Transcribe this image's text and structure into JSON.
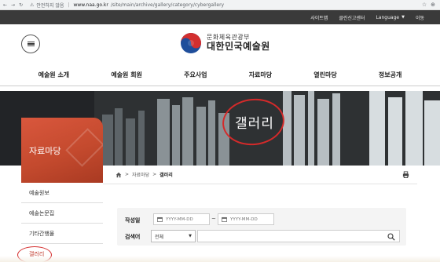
{
  "browser": {
    "security_label": "안전하지 않음",
    "url_host": "www.naa.go.kr",
    "url_path": "/site/main/archive/gallery/category/cybergallery"
  },
  "util_bar": {
    "items": [
      "사이트맵",
      "클린신고센터",
      "Language",
      "이동"
    ]
  },
  "header": {
    "logo_sub": "문화체육관광부",
    "logo_main": "대한민국예술원"
  },
  "gnb": {
    "items": [
      "예술원 소개",
      "예술원 회원",
      "주요사업",
      "자료마당",
      "열린마당",
      "정보공개"
    ]
  },
  "banner": {
    "title": "갤러리"
  },
  "sidebar": {
    "title": "자료마당",
    "items": [
      {
        "label": "예술원보",
        "active": false
      },
      {
        "label": "예술논문집",
        "active": false
      },
      {
        "label": "기타간행물",
        "active": false
      },
      {
        "label": "갤러리",
        "active": true
      }
    ]
  },
  "breadcrumb": {
    "level1": "자료마당",
    "current": "갤러리"
  },
  "search": {
    "date_label": "작성일",
    "date_from_placeholder": "YYYY-MM-DD",
    "date_to_placeholder": "YYYY-MM-DD",
    "tilde": "~",
    "keyword_label": "검색어",
    "select_value": "전체",
    "keyword_value": ""
  },
  "colors": {
    "accent": "#c44a2e",
    "annotation": "#d42a2a",
    "util_bar_bg": "#3a3a3a"
  }
}
